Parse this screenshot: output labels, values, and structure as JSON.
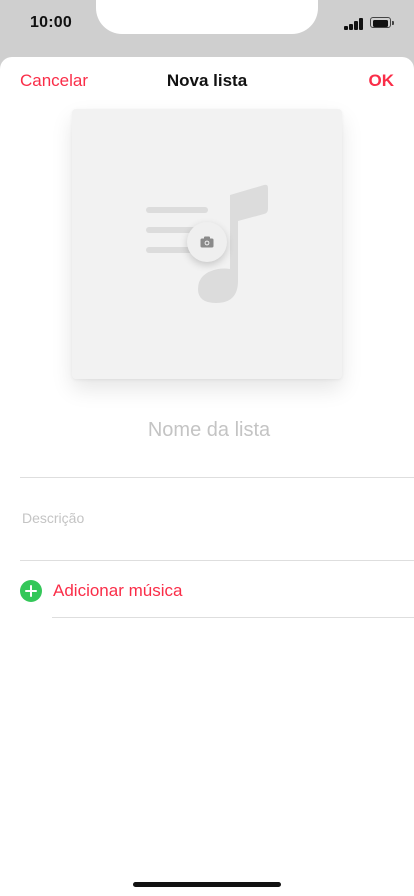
{
  "status_bar": {
    "time": "10:00",
    "signal_icon": "cellular-signal-icon",
    "battery_icon": "battery-icon"
  },
  "nav": {
    "cancel_label": "Cancelar",
    "title": "Nova lista",
    "done_label": "OK"
  },
  "artwork": {
    "placeholder_icon": "music-note-list-icon",
    "camera_icon": "camera-icon"
  },
  "form": {
    "name_placeholder": "Nome da lista",
    "name_value": "",
    "description_placeholder": "Descrição",
    "description_value": ""
  },
  "add_music": {
    "label": "Adicionar música",
    "icon": "plus-circle-icon"
  },
  "colors": {
    "accent": "#fa2d48",
    "add_icon": "#34c759",
    "placeholder_text": "#c4c4c4"
  }
}
